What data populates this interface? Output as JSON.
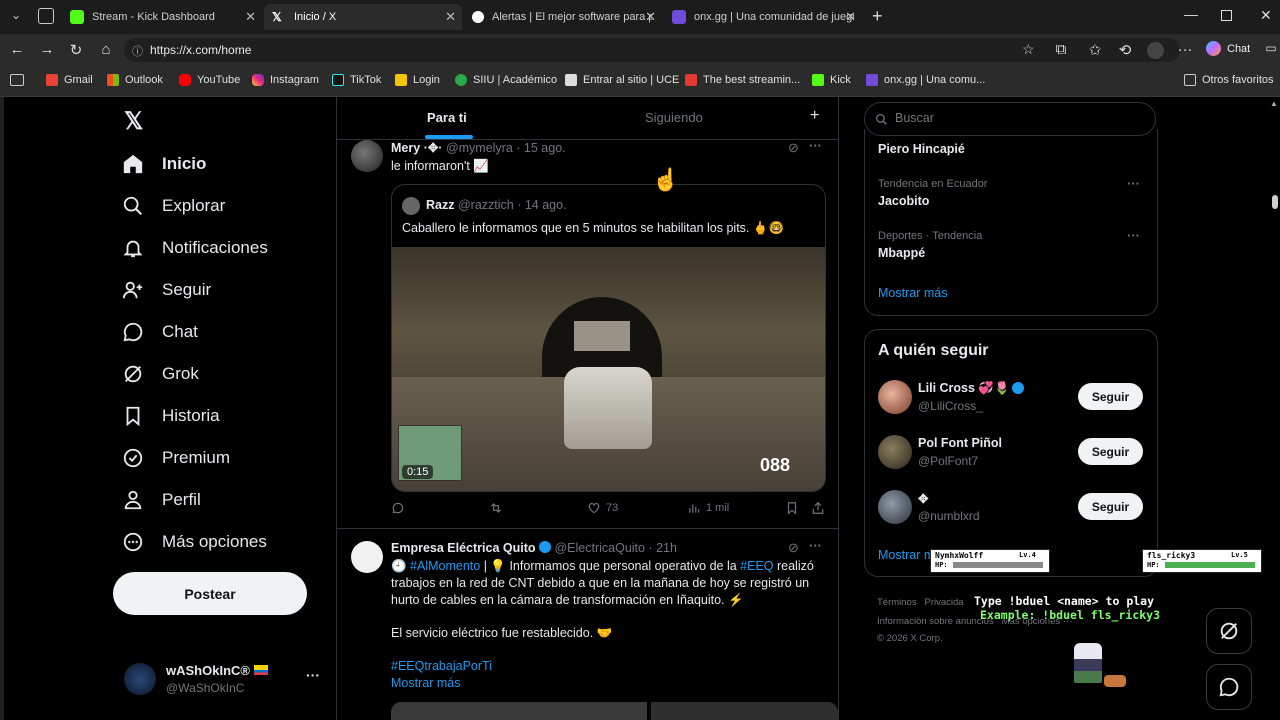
{
  "tabs": [
    {
      "label": "Stream - Kick Dashboard",
      "icon": "kick-icon"
    },
    {
      "label": "Inicio / X",
      "icon": "x-logo-icon"
    },
    {
      "label": "Alertas | El mejor software para po",
      "icon": "streamelements-icon"
    },
    {
      "label": "onx.gg | Una comunidad de juego",
      "icon": "onx-icon"
    }
  ],
  "address": {
    "url": "https://x.com/home"
  },
  "browser": {
    "chat_label": "Chat"
  },
  "bookmarks": [
    "Gmail",
    "Outlook",
    "YouTube",
    "Instagram",
    "TikTok",
    "Login",
    "SIIU | Académico",
    "Entrar al sitio | UCE",
    "The best streamin...",
    "Kick",
    "onx.gg | Una comu..."
  ],
  "bookmarks_other": "Otros favoritos",
  "nav": {
    "items": [
      "Inicio",
      "Explorar",
      "Notificaciones",
      "Seguir",
      "Chat",
      "Grok",
      "Historia",
      "Premium",
      "Perfil",
      "Más opciones"
    ],
    "post_label": "Postear",
    "profile_name": "wAShOkInC®",
    "profile_handle": "@WaShOkInC"
  },
  "feed": {
    "tabs": [
      "Para ti",
      "Siguiendo"
    ],
    "tweet1": {
      "name": "Mery ·✥·",
      "handle": "@mymelyra",
      "time": "· 15 ago.",
      "text": "le informaron't 📈",
      "quote": {
        "name": "Razz",
        "handle": "@razztich",
        "time": "· 14 ago.",
        "text": "Caballero le informamos que en 5 minutos se habilitan los pits. 🖕🤓",
        "video_time": "0:15",
        "hud_speed": "088"
      },
      "likes": "73",
      "views": "1 mil"
    },
    "tweet2": {
      "name": "Empresa Eléctrica Quito",
      "handle": "@ElectricaQuito",
      "time": "· 21h",
      "line1_hashtag": "#AlMomento",
      "line1_text": " | 💡 Informamos que personal operativo de la ",
      "line1_hashtag2": "#EEQ",
      "line1_rest": " realizó",
      "line2": "trabajos en la red de CNT debido a que en la mañana de hoy se registró un",
      "line3": "hurto de cables en la cámara de transformación en Iñaquito. ⚡",
      "line4": "El servicio eléctrico fue restablecido. 🤝",
      "hashtag": "#EEQtrabajaPorTi",
      "more": "Mostrar más"
    }
  },
  "right": {
    "search_placeholder": "Buscar",
    "trends": [
      {
        "category": "",
        "name": "Piero Hincapié"
      },
      {
        "category": "Tendencia en Ecuador",
        "name": "Jacobito"
      },
      {
        "category": "Deportes · Tendencia",
        "name": "Mbappé"
      }
    ],
    "show_more": "Mostrar más",
    "follow_title": "A quién seguir",
    "follow": [
      {
        "name": "Lili Cross 💞🌷",
        "handle": "@LiliCross_"
      },
      {
        "name": "Pol Font Piñol",
        "handle": "@PolFont7"
      },
      {
        "name": "✥",
        "handle": "@numblxrd"
      }
    ],
    "follow_btn": "Seguir",
    "show_more2": "Mostrar m",
    "footer1": "Términos   Privacida",
    "footer2": "Información sobre anuncios   Más opciones ···",
    "footer3": "© 2026 X Corp."
  },
  "overlay": {
    "player1": "NymhxWolff",
    "player1_lv": "Lv.4",
    "player2": "fls_ricky3",
    "player2_lv": "Lv.5",
    "hp": "HP:",
    "instr1": "Type !bduel <name> to play",
    "instr2": "Example: !bduel fls_ricky3"
  },
  "colors": {
    "accent": "#1d9bf0",
    "bg": "#000000",
    "border": "#2f3336",
    "muted": "#71767b"
  }
}
